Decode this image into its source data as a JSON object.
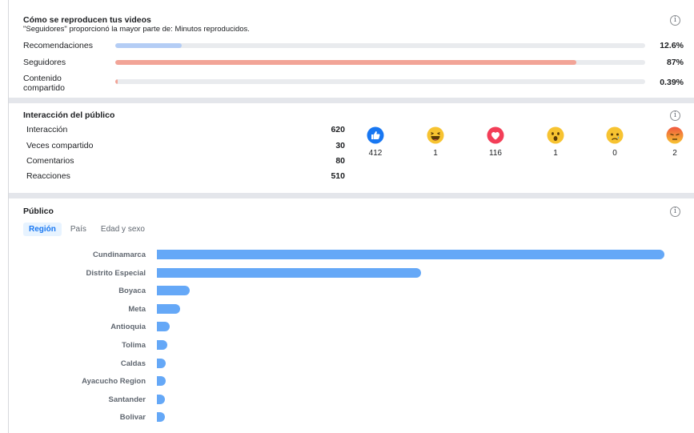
{
  "playback": {
    "title": "Cómo se reproducen tus videos",
    "subtitle": "\"Seguidores\" proporcionó la mayor parte de: Minutos reproducidos.",
    "info_icon": "info-icon",
    "rows": [
      {
        "label": "Recomendaciones",
        "value": "12.6%",
        "percent": 12.6,
        "color": "#b4cdf5"
      },
      {
        "label": "Seguidores",
        "value": "87%",
        "percent": 87,
        "color": "#f2a497"
      },
      {
        "label": "Contenido compartido",
        "value": "0.39%",
        "percent": 0.39,
        "color": "#f2a497"
      }
    ]
  },
  "engagement": {
    "title": "Interacción del público",
    "info_icon": "info-icon",
    "metrics": [
      {
        "label": "Interacción",
        "value": "620"
      },
      {
        "label": "Veces compartido",
        "value": "30"
      },
      {
        "label": "Comentarios",
        "value": "80"
      },
      {
        "label": "Reacciones",
        "value": "510"
      }
    ],
    "reactions": [
      {
        "icon": "like-icon",
        "count": "412"
      },
      {
        "icon": "haha-icon",
        "count": "1"
      },
      {
        "icon": "love-icon",
        "count": "116"
      },
      {
        "icon": "wow-icon",
        "count": "1"
      },
      {
        "icon": "sad-icon",
        "count": "0"
      },
      {
        "icon": "angry-icon",
        "count": "2"
      }
    ]
  },
  "audience": {
    "title": "Público",
    "info_icon": "info-icon",
    "tabs": [
      {
        "label": "Región",
        "active": true
      },
      {
        "label": "País",
        "active": false
      },
      {
        "label": "Edad y sexo",
        "active": false
      }
    ],
    "bar_color": "#65a8f7"
  },
  "chart_data": {
    "type": "bar",
    "orientation": "horizontal",
    "categories": [
      "Cundinamarca",
      "Distrito Especial",
      "Boyaca",
      "Meta",
      "Antioquia",
      "Tolima",
      "Caldas",
      "Ayacucho Region",
      "Santander",
      "Bolivar"
    ],
    "values": [
      100,
      52,
      6.5,
      4.5,
      2.5,
      2,
      1.8,
      1.7,
      1.6,
      1.5
    ],
    "grid": false,
    "legend": "none"
  }
}
